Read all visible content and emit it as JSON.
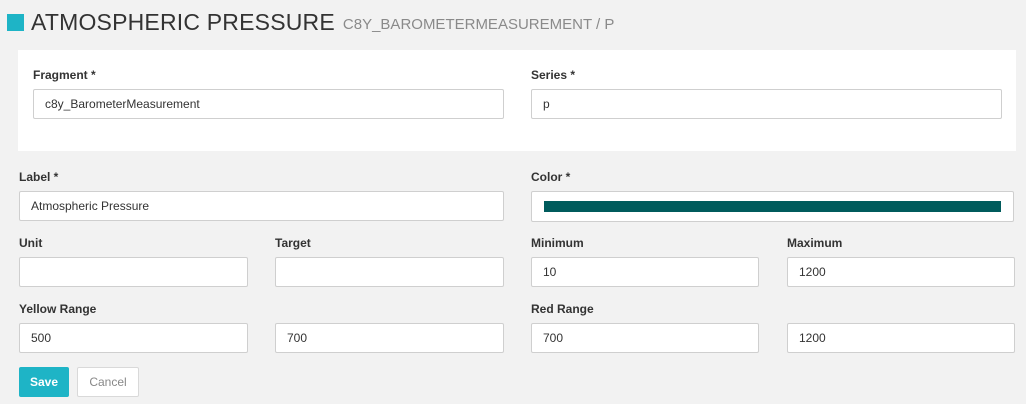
{
  "header": {
    "title": "ATMOSPHERIC PRESSURE",
    "subtitle": "C8Y_BAROMETERMEASUREMENT / P",
    "accent_color": "#1eb4c6"
  },
  "fragment": {
    "label": "Fragment *",
    "value": "c8y_BarometerMeasurement"
  },
  "series": {
    "label": "Series *",
    "value": "p"
  },
  "label_field": {
    "label": "Label *",
    "value": "Atmospheric Pressure"
  },
  "color_field": {
    "label": "Color *",
    "value": "#005b5c"
  },
  "unit": {
    "label": "Unit",
    "value": ""
  },
  "target": {
    "label": "Target",
    "value": ""
  },
  "minimum": {
    "label": "Minimum",
    "value": "10"
  },
  "maximum": {
    "label": "Maximum",
    "value": "1200"
  },
  "yellow_range": {
    "label": "Yellow Range",
    "from": "500",
    "to": "700"
  },
  "red_range": {
    "label": "Red Range",
    "from": "700",
    "to": "1200"
  },
  "buttons": {
    "save": "Save",
    "cancel": "Cancel"
  }
}
